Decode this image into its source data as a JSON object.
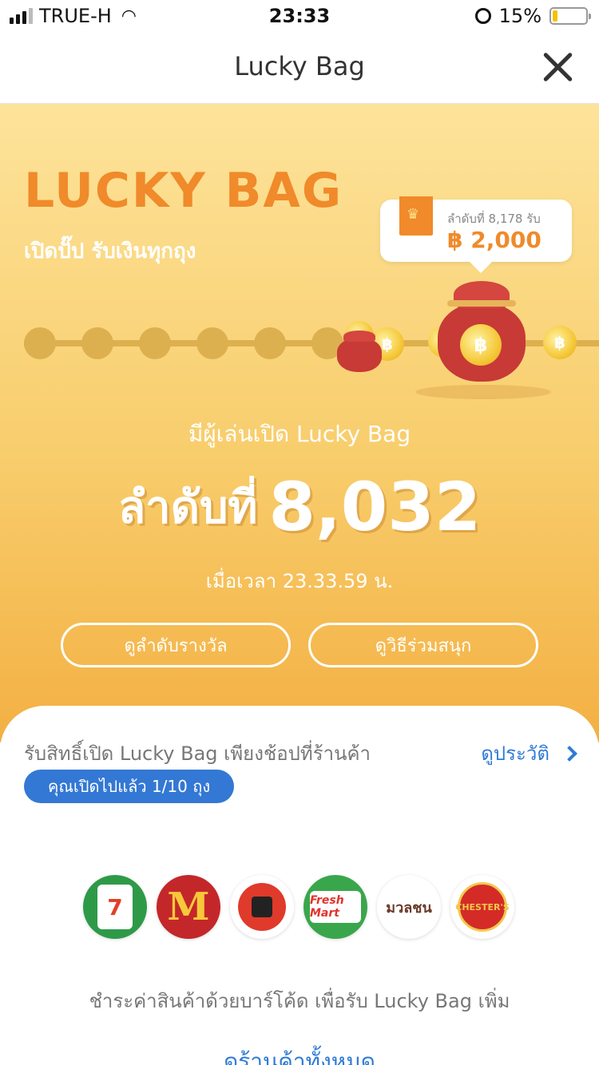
{
  "status_bar": {
    "carrier": "TRUE-H",
    "time": "23:33",
    "battery": "15%",
    "battery_level": 0.15
  },
  "nav": {
    "title": "Lucky Bag"
  },
  "hero": {
    "brand": "LUCKY  BAG",
    "tagline": "เปิดปั๊ป รับเงินทุกถุง",
    "coin_symbol": "฿",
    "prize_badge": {
      "rank_text": "ลำดับที่ 8,178 รับ",
      "amount": "฿ 2,000"
    },
    "players_text": "มีผู้เล่นเปิด Lucky Bag",
    "rank_label": "ลำดับที่",
    "rank_number": "8,032",
    "time_text": "เมื่อเวลา 23.33.59 น.",
    "buttons": {
      "view_rewards": "ดูลำดับรางวัล",
      "how_to_play": "ดูวิธีร่วมสนุก"
    }
  },
  "sheet": {
    "info_text": "รับสิทธิ์เปิด Lucky Bag เพียงช้อปที่ร้านค้า",
    "history_link": "ดูประวัติ",
    "opened_pill": "คุณเปิดไปแล้ว 1/10 ถุง",
    "stores": [
      {
        "name": "7-Eleven",
        "mark": "7",
        "icon": "seven-eleven-logo"
      },
      {
        "name": "McDonald's",
        "mark": "M",
        "icon": "mcdonalds-logo"
      },
      {
        "name": "True Coffee",
        "icon": "true-coffee-logo"
      },
      {
        "name": "CP Fresh Mart",
        "mark": "Fresh Mart",
        "icon": "cp-freshmart-logo"
      },
      {
        "name": "Mezzo Cafe",
        "mark": "มวลชน",
        "icon": "cafe-logo"
      },
      {
        "name": "Chester's",
        "mark": "CHESTER'S",
        "icon": "chesters-logo"
      }
    ],
    "pay_text": "ชำระค่าสินค้าด้วยบาร์โค้ด เพื่อรับ Lucky Bag เพิ่ม",
    "all_stores_link": "ดูร้านค้าทั้งหมด"
  },
  "colors": {
    "accent_orange": "#f08a2a",
    "link_blue": "#2f7bd6",
    "pill_blue": "#3378d4",
    "bag_red": "#c73a36"
  }
}
